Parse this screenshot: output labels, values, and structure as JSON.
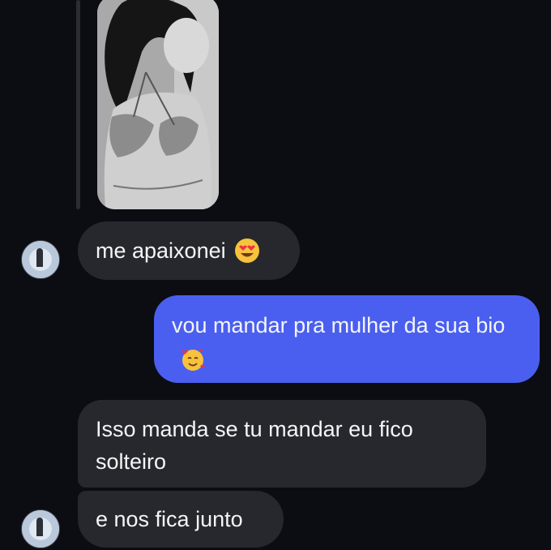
{
  "messages": [
    {
      "sender": "them",
      "text": "me apaixonei",
      "emoji": "heart-eyes-emoji"
    },
    {
      "sender": "me",
      "text": "vou mandar pra mulher da sua bio",
      "emoji": "smiling-face-with-hearts-emoji"
    },
    {
      "sender": "them",
      "text": "Isso manda se tu mandar eu fico solteiro"
    },
    {
      "sender": "them",
      "text": "e nos fica junto"
    }
  ],
  "colors": {
    "background": "#0b0d12",
    "incoming_bubble": "#26282d",
    "outgoing_bubble": "#4a5ff0",
    "text": "#f4f5f7"
  }
}
